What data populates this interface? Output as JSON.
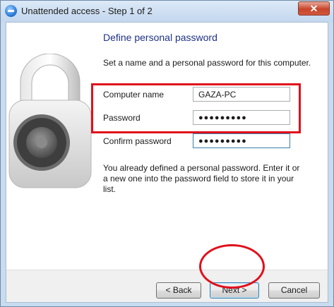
{
  "window": {
    "title": "Unattended access - Step 1 of 2",
    "close_symbol": "✕"
  },
  "page": {
    "heading": "Define personal password",
    "description": "Set a name and a personal password for this computer.",
    "computer_name_label": "Computer name",
    "computer_name_value": "GAZA-PC",
    "password_label": "Password",
    "password_value": "●●●●●●●●●",
    "confirm_label": "Confirm password",
    "confirm_value": "●●●●●●●●●",
    "note": "You already defined a personal password. Enter it or a new one into the password field to store it in your list."
  },
  "buttons": {
    "back": "< Back",
    "next": "Next >",
    "cancel": "Cancel"
  },
  "colors": {
    "annotation": "#e0101b",
    "heading": "#1e3287"
  }
}
